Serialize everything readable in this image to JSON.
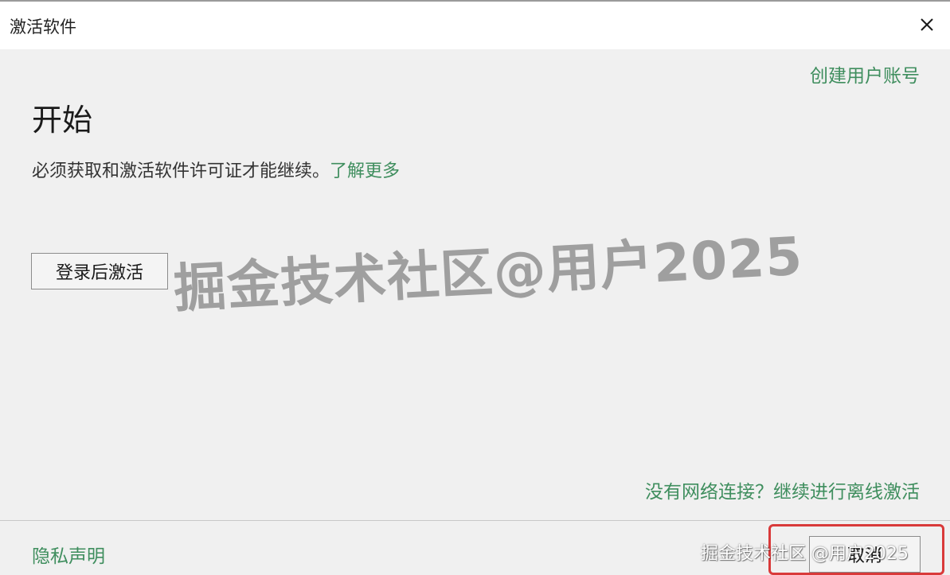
{
  "window": {
    "title": "激活软件"
  },
  "links": {
    "create_account": "创建用户账号",
    "learn_more": "了解更多",
    "offline_activation": "没有网络连接？继续进行离线激活",
    "privacy": "隐私声明"
  },
  "main": {
    "heading": "开始",
    "description": "必须获取和激活软件许可证才能继续。"
  },
  "buttons": {
    "sign_in_activate": "登录后激活",
    "cancel": "取消"
  },
  "watermarks": {
    "large": "掘金技术社区@用户2025",
    "small": "掘金技术社区 @用户2025"
  },
  "colors": {
    "link_green": "#3f8e5e",
    "highlight_red": "#d93a3a",
    "background": "#f0f0f0"
  },
  "icons": {
    "close": "close-icon"
  }
}
